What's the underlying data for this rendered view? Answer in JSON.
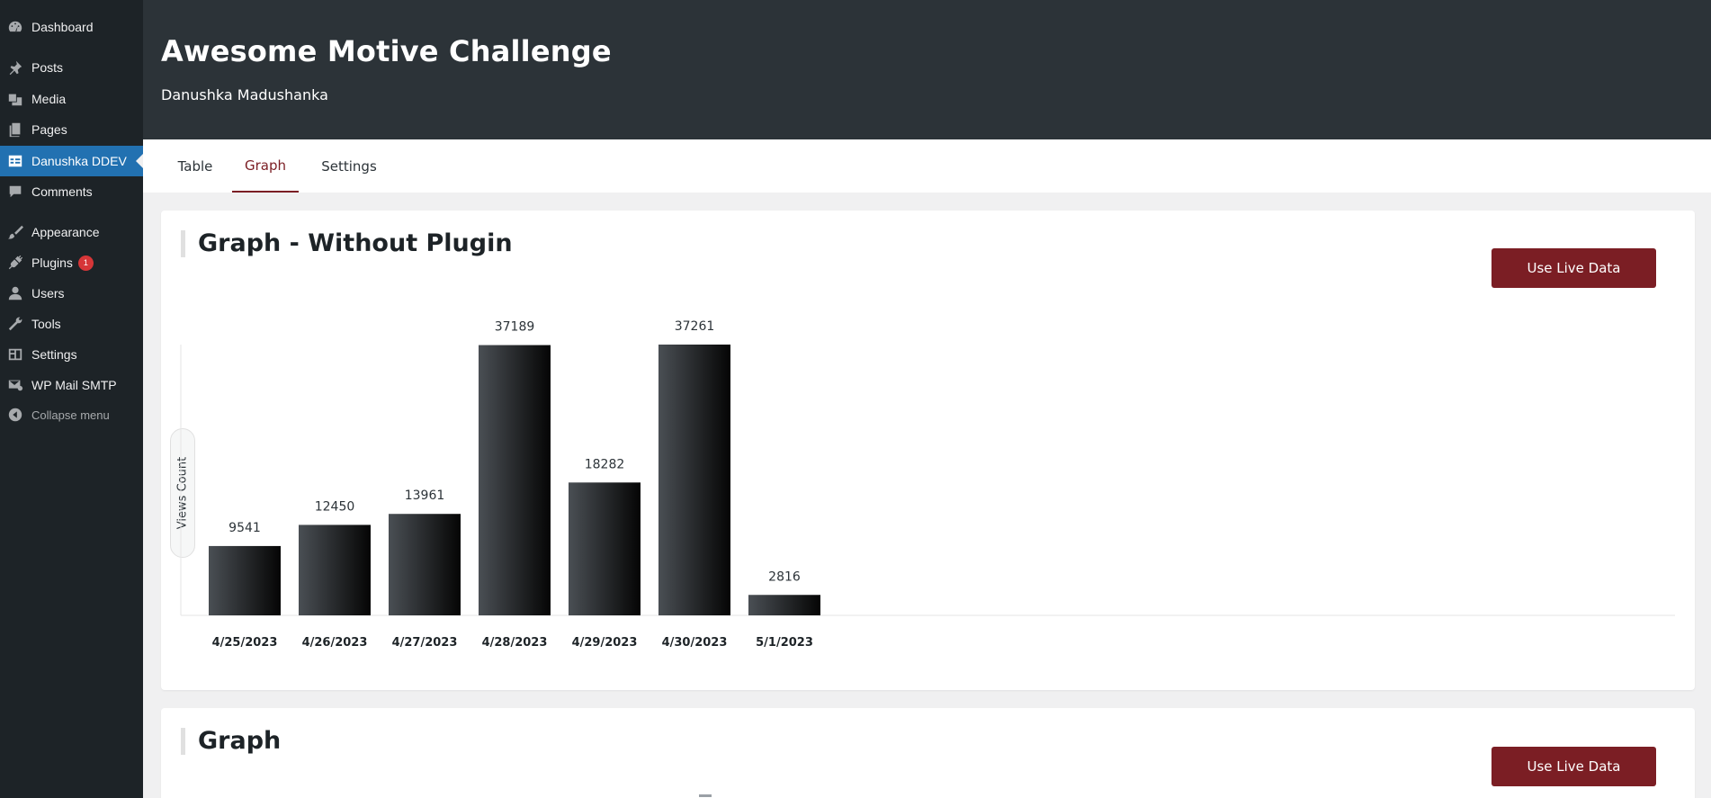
{
  "sidebar": {
    "items": [
      {
        "label": "Dashboard",
        "icon": "dashboard-icon"
      },
      {
        "label": "Posts",
        "icon": "pin-icon"
      },
      {
        "label": "Media",
        "icon": "media-icon"
      },
      {
        "label": "Pages",
        "icon": "pages-icon"
      },
      {
        "label": "Danushka DDEV",
        "icon": "table-icon",
        "active": true
      },
      {
        "label": "Comments",
        "icon": "comment-icon"
      },
      {
        "label": "Appearance",
        "icon": "brush-icon"
      },
      {
        "label": "Plugins",
        "icon": "plugin-icon",
        "badge": "1"
      },
      {
        "label": "Users",
        "icon": "user-icon"
      },
      {
        "label": "Tools",
        "icon": "wrench-icon"
      },
      {
        "label": "Settings",
        "icon": "settings-icon"
      },
      {
        "label": "WP Mail SMTP",
        "icon": "mail-icon"
      },
      {
        "label": "Collapse menu",
        "icon": "collapse-icon"
      }
    ]
  },
  "header": {
    "title": "Awesome Motive Challenge",
    "subtitle": "Danushka Madushanka"
  },
  "tabs": [
    {
      "label": "Table"
    },
    {
      "label": "Graph",
      "active": true
    },
    {
      "label": "Settings"
    }
  ],
  "cards": [
    {
      "title": "Graph - Without Plugin",
      "button_label": "Use Live Data"
    },
    {
      "title": "Graph",
      "button_label": "Use Live Data"
    }
  ],
  "colors": {
    "accent": "#7b1e24",
    "sidebar_bg": "#1d2327",
    "header_bg": "#2c3338",
    "active_menu": "#2271b1",
    "badge": "#d63638"
  },
  "chart_data": {
    "type": "bar",
    "categories": [
      "4/25/2023",
      "4/26/2023",
      "4/27/2023",
      "4/28/2023",
      "4/29/2023",
      "4/30/2023",
      "5/1/2023"
    ],
    "values": [
      9541,
      12450,
      13961,
      37189,
      18282,
      37261,
      2816
    ],
    "ylabel": "Views Count",
    "data_labels": true,
    "grid": false
  }
}
